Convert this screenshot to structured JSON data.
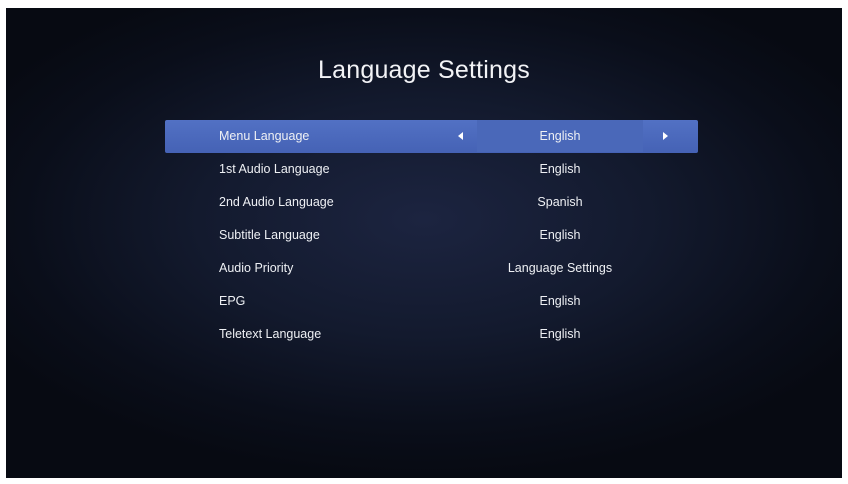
{
  "screen": {
    "title": "Language Settings"
  },
  "menu": {
    "selected_index": 0,
    "items": [
      {
        "label": "Menu Language",
        "value": "English"
      },
      {
        "label": "1st Audio Language",
        "value": "English"
      },
      {
        "label": "2nd Audio Language",
        "value": "Spanish"
      },
      {
        "label": "Subtitle Language",
        "value": "English"
      },
      {
        "label": "Audio Priority",
        "value": "Language Settings"
      },
      {
        "label": "EPG",
        "value": "English"
      },
      {
        "label": "Teletext Language",
        "value": "English"
      }
    ],
    "left_arrow_icon": "triangle-left-icon",
    "right_arrow_icon": "triangle-right-icon"
  },
  "colors": {
    "highlight": "#4a68b9",
    "text": "#eef0f4",
    "background": "#131a2e"
  }
}
